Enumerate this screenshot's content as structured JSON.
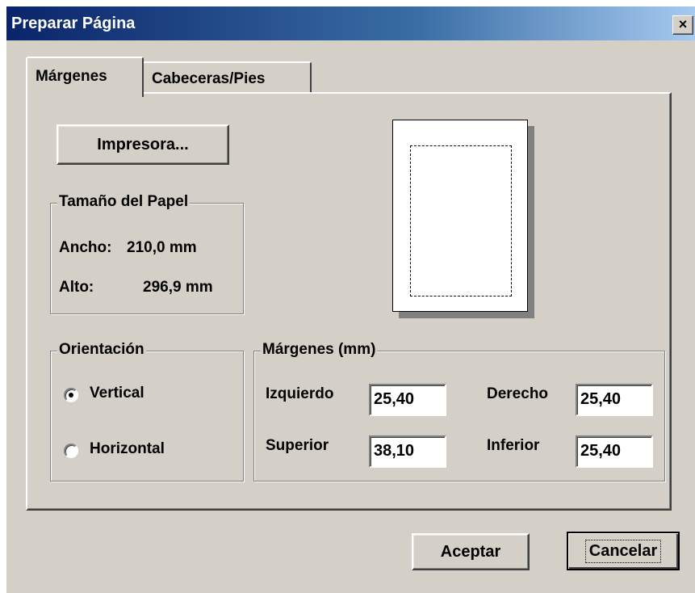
{
  "window": {
    "title": "Preparar Página",
    "close_glyph": "×"
  },
  "tabs": [
    {
      "label": "Márgenes"
    },
    {
      "label": "Cabeceras/Pies"
    }
  ],
  "printer_button": {
    "label": "Impresora..."
  },
  "paper_size": {
    "legend": "Tamaño del Papel",
    "width_label": "Ancho:",
    "width_value": "210,0 mm",
    "height_label": "Alto:",
    "height_value": "296,9 mm"
  },
  "orientation": {
    "legend": "Orientación",
    "options": [
      {
        "label": "Vertical",
        "selected": true
      },
      {
        "label": "Horizontal",
        "selected": false
      }
    ]
  },
  "margins": {
    "legend": "Márgenes (mm)",
    "left_label": "Izquierdo",
    "left_value": "25,40",
    "right_label": "Derecho",
    "right_value": "25,40",
    "top_label": "Superior",
    "top_value": "38,10",
    "bottom_label": "Inferior",
    "bottom_value": "25,40"
  },
  "buttons": {
    "ok": "Aceptar",
    "cancel": "Cancelar"
  },
  "colors": {
    "dialog_face": "#d4d0c8",
    "title_bar_start": "#0a246a",
    "title_bar_end": "#a6caf0"
  }
}
